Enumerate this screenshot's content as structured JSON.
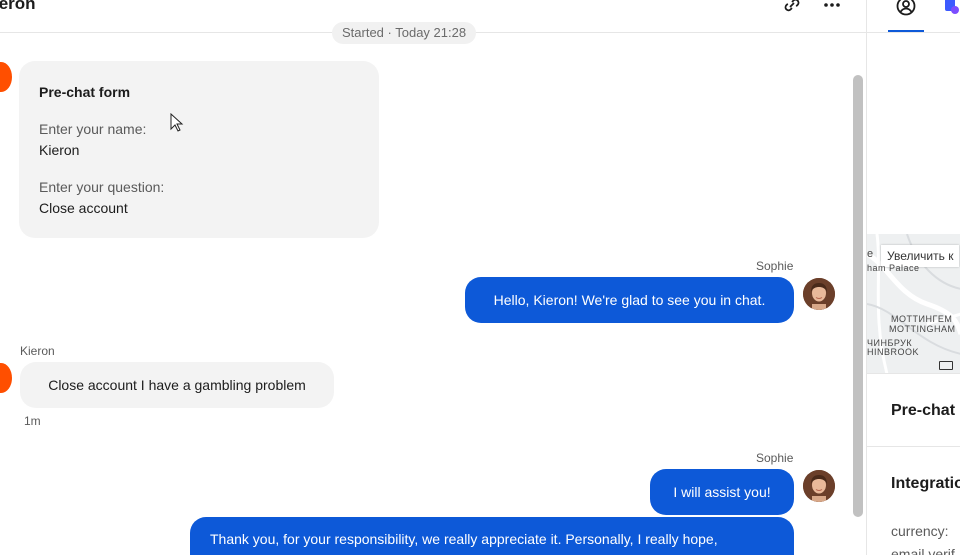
{
  "header": {
    "title": "ieron",
    "link_icon": "link-icon",
    "more_icon": "more-horizontal-icon"
  },
  "chat": {
    "started": "Started · Today 21:28",
    "prechat_form": {
      "title": "Pre-chat form",
      "name_question": "Enter your name:",
      "name_answer": "Kieron",
      "question_label": "Enter your question:",
      "question_answer": "Close account"
    },
    "messages": [
      {
        "sender": "Sophie",
        "text": "Hello, Kieron! We're glad to see you in chat.",
        "direction": "out"
      },
      {
        "sender": "Kieron",
        "text": "Close account I have a gambling problem",
        "direction": "in",
        "time": "1m"
      },
      {
        "sender": "Sophie",
        "text": "I will assist you!",
        "direction": "out"
      },
      {
        "sender": "",
        "text": "Thank you, for your responsibility, we really appreciate it. Personally, I really hope,",
        "direction": "out"
      }
    ]
  },
  "right_panel": {
    "tabs": [
      {
        "icon": "user-circle-icon",
        "active": true
      },
      {
        "icon": "app-icon",
        "active": false
      }
    ],
    "map": {
      "zoom_label": "Увеличить к",
      "label_palace": "ham Palace",
      "label_ru1": "МОТТИНГЕМ",
      "label_en1": "MOTTINGHAM",
      "label_ru2": "ЧИНБРУК",
      "label_en2": "HINBROOK",
      "label_top": "e"
    },
    "sections": {
      "prechat": "Pre-chat",
      "integrations": "Integratio",
      "currency_label": "currency:",
      "email_label": "email verif"
    }
  },
  "colors": {
    "accent": "#0d59d8",
    "customer_avatar": "#ff4f00",
    "bubble_in": "#f3f3f3"
  }
}
